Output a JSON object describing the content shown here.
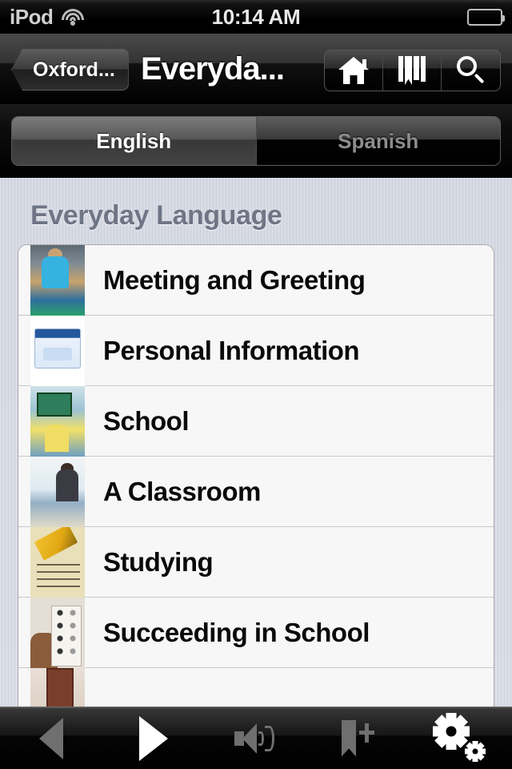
{
  "status_bar": {
    "carrier": "iPod",
    "wifi_icon": "wifi-icon",
    "time": "10:14 AM",
    "battery_icon": "battery-icon"
  },
  "nav_bar": {
    "back_label": "Oxford...",
    "title": "Everyda...",
    "buttons": [
      {
        "name": "home-icon",
        "label": "Home"
      },
      {
        "name": "bookmarks-icon",
        "label": "Bookmarks"
      },
      {
        "name": "search-icon",
        "label": "Search"
      }
    ]
  },
  "language_tabs": {
    "selected": "English",
    "options": [
      {
        "label": "English",
        "selected": true
      },
      {
        "label": "Spanish",
        "selected": false
      }
    ]
  },
  "main": {
    "section_title": "Everyday Language",
    "list": [
      {
        "label": "Meeting and Greeting",
        "thumb": "greeting-thumbnail"
      },
      {
        "label": "Personal Information",
        "thumb": "social-security-card-thumbnail"
      },
      {
        "label": "School",
        "thumb": "school-thumbnail"
      },
      {
        "label": "A Classroom",
        "thumb": "classroom-thumbnail"
      },
      {
        "label": "Studying",
        "thumb": "studying-thumbnail"
      },
      {
        "label": "Succeeding in School",
        "thumb": "test-answer-sheet-thumbnail"
      },
      {
        "label": "",
        "thumb": "doorway-thumbnail"
      }
    ]
  },
  "toolbar": {
    "buttons": [
      {
        "name": "previous-button",
        "icon": "previous-arrow-icon",
        "enabled": false
      },
      {
        "name": "play-button",
        "icon": "play-icon",
        "enabled": true
      },
      {
        "name": "audio-button",
        "icon": "speaker-icon",
        "enabled": false
      },
      {
        "name": "add-bookmark-button",
        "icon": "bookmark-plus-icon",
        "enabled": false
      },
      {
        "name": "settings-button",
        "icon": "gears-icon",
        "enabled": true
      }
    ]
  },
  "colors": {
    "content_background": "#d3d7e0",
    "row_background": "#f7f7f7",
    "section_title": "#6e7585",
    "nav_background": "#000000"
  }
}
